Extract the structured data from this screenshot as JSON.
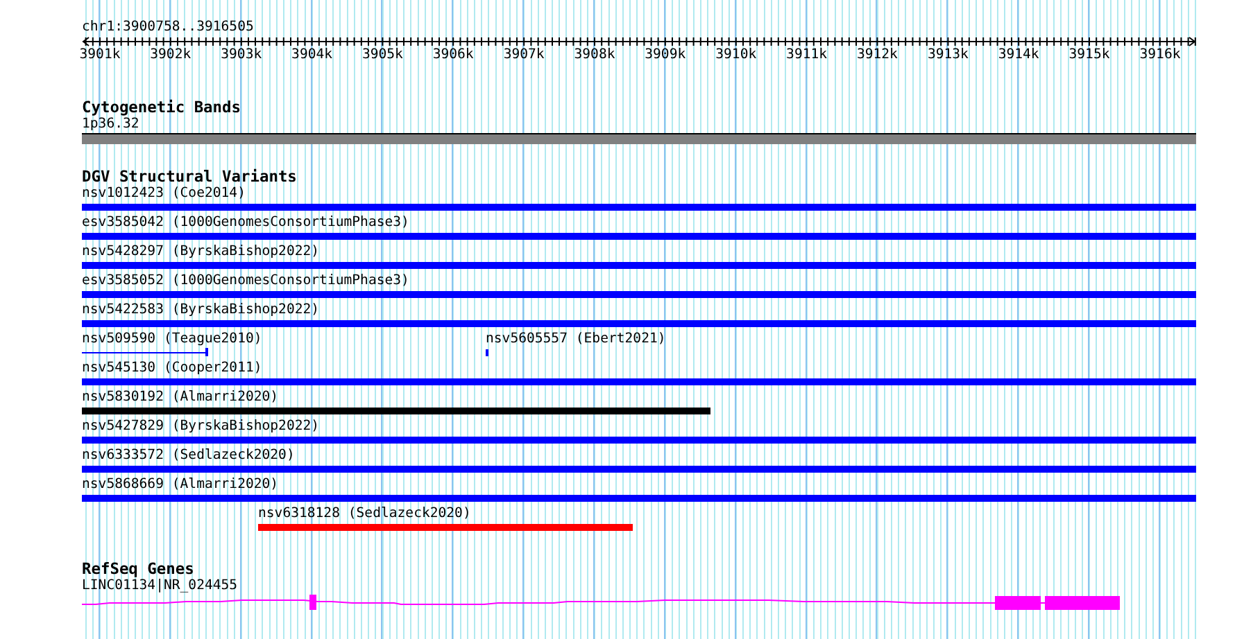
{
  "location": "chr1:3900758..3916505",
  "ruler": {
    "ticks": [
      "3901k",
      "3902k",
      "3903k",
      "3904k",
      "3905k",
      "3906k",
      "3907k",
      "3908k",
      "3909k",
      "3910k",
      "3911k",
      "3912k",
      "3913k",
      "3914k",
      "3915k",
      "3916k"
    ]
  },
  "tracks": [
    {
      "kind": "cytoband",
      "title": "Cytogenetic Bands",
      "features": [
        {
          "label": "1p36.32"
        }
      ]
    },
    {
      "kind": "variants",
      "title": "DGV Structural Variants",
      "rows": [
        {
          "features": [
            {
              "label": "nsv1012423 (Coe2014)",
              "kind": "bar",
              "color": "#0000ff"
            }
          ]
        },
        {
          "features": [
            {
              "label": "esv3585042 (1000GenomesConsortiumPhase3)",
              "kind": "bar",
              "color": "#0000ff"
            }
          ]
        },
        {
          "features": [
            {
              "label": "nsv5428297 (ByrskaBishop2022)",
              "kind": "bar",
              "color": "#0000ff"
            }
          ]
        },
        {
          "features": [
            {
              "label": "esv3585052 (1000GenomesConsortiumPhase3)",
              "kind": "bar",
              "color": "#0000ff"
            }
          ]
        },
        {
          "features": [
            {
              "label": "nsv5422583 (ByrskaBishop2022)",
              "kind": "bar",
              "color": "#0000ff"
            }
          ]
        },
        {
          "features": [
            {
              "label": "nsv509590 (Teague2010)",
              "kind": "line",
              "color": "#0000ff"
            },
            {
              "label": "nsv5605557 (Ebert2021)",
              "kind": "tick",
              "color": "#0000ff"
            }
          ]
        },
        {
          "features": [
            {
              "label": "nsv545130 (Cooper2011)",
              "kind": "bar",
              "color": "#0000ff"
            }
          ]
        },
        {
          "features": [
            {
              "label": "nsv5830192 (Almarri2020)",
              "kind": "bar",
              "color": "#000000"
            }
          ]
        },
        {
          "features": [
            {
              "label": "nsv5427829 (ByrskaBishop2022)",
              "kind": "bar",
              "color": "#0000ff"
            }
          ]
        },
        {
          "features": [
            {
              "label": "nsv6333572 (Sedlazeck2020)",
              "kind": "bar",
              "color": "#0000ff"
            }
          ]
        },
        {
          "features": [
            {
              "label": "nsv5868669 (Almarri2020)",
              "kind": "bar",
              "color": "#0000ff"
            }
          ]
        },
        {
          "features": [
            {
              "label": "nsv6318128 (Sedlazeck2020)",
              "kind": "bar",
              "color": "#ff0000"
            }
          ]
        }
      ]
    },
    {
      "kind": "genes",
      "title": "RefSeq Genes",
      "features": [
        {
          "label": "LINC01134|NR_024455"
        }
      ]
    }
  ]
}
